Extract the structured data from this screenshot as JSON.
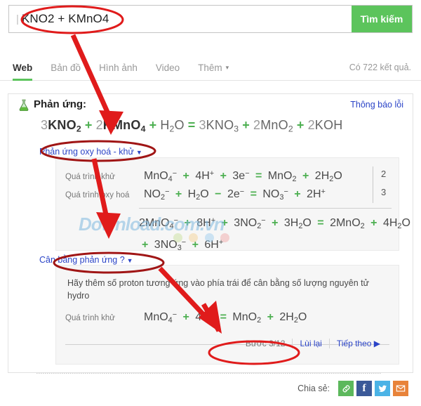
{
  "search": {
    "query": "KNO2 + KMnO4",
    "button_label": "Tìm kiếm",
    "caret_icon": "text-caret-icon"
  },
  "nav": {
    "tabs": [
      {
        "label": "Web",
        "active": true
      },
      {
        "label": "Bản đồ",
        "active": false
      },
      {
        "label": "Hình ảnh",
        "active": false
      },
      {
        "label": "Video",
        "active": false
      },
      {
        "label": "Thêm",
        "active": false,
        "caret": "▾"
      }
    ],
    "result_count": "Có 722 kết quả."
  },
  "card": {
    "icon": "flask-icon",
    "title": "Phản ứng:",
    "report_link": "Thông báo lỗi",
    "main_equation": {
      "left": [
        {
          "coef": "3",
          "formula": "KNO",
          "sub": "2",
          "highlight": true
        },
        {
          "coef": "2",
          "formula": "KMnO",
          "sub": "4",
          "highlight": true
        },
        {
          "coef": "",
          "formula": "H",
          "sub": "2",
          "formula2": "O",
          "highlight": false
        }
      ],
      "right": [
        {
          "coef": "3",
          "formula": "KNO",
          "sub": "3"
        },
        {
          "coef": "2",
          "formula": "MnO",
          "sub": "2"
        },
        {
          "coef": "2",
          "formula": "KOH",
          "sub": ""
        }
      ],
      "plus": "+",
      "equals": "="
    },
    "redox": {
      "toggle_label": "Phản ứng oxy hoá - khử",
      "toggle_caret": "▼",
      "rows": [
        {
          "label": "Quá trình khử",
          "equation_html": "MnO<sub>4</sub><sup>−</sup> <span class=\"op\">+</span> 4H<sup>+</sup> <span class=\"op\">+</span> 3e<sup>−</sup> <span class=\"eqs\">=</span> MnO<sub>2</sub> <span class=\"op\">+</span> 2H<sub>2</sub>O",
          "multiplier": "2"
        },
        {
          "label": "Quá trình oxy hoá",
          "equation_html": "NO<sub>2</sub><sup>−</sup> <span class=\"op\">+</span> H<sub>2</sub>O <span class=\"op\">−</span> 2e<sup>−</sup> <span class=\"eqs\">=</span> NO<sub>3</sub><sup>−</sup> <span class=\"op\">+</span> 2H<sup>+</sup>",
          "multiplier": "3"
        }
      ],
      "sum_equation_html": "2MnO<sub>4</sub><sup>−</sup> <span class=\"op\">+</span> 8H<sup>+</sup> <span class=\"op\">+</span> 3NO<sub>2</sub><sup>−</sup> <span class=\"op\">+</span> 3H<sub>2</sub>O <span class=\"op\">=</span> 2MnO<sub>2</sub> <span class=\"op\">+</span> 4H<sub>2</sub>O <span class=\"op\">+</span> 3NO<sub>3</sub><sup>−</sup> <span class=\"op\">+</span> 6H<sup>+</sup>"
    },
    "balance": {
      "toggle_label": "Cân bằng phản ứng ?",
      "toggle_caret": "▼",
      "hint": "Hãy thêm số proton tương ứng vào phía trái để cân bằng số lượng nguyên tử hydro",
      "row": {
        "label": "Quá trình khử",
        "equation_html": "MnO<sub>4</sub><sup>−</sup> <span class=\"op\">+</span> 4H<sup>+</sup> <span class=\"op\">=</span> MnO<sub>2</sub> <span class=\"op\">+</span> 2H<sub>2</sub>O"
      },
      "step_text": "Bước 3/12",
      "back_label": "Lùi lại",
      "next_label": "Tiếp theo ▶"
    }
  },
  "watermark": {
    "text": "Download.com.vn",
    "dot_colors": [
      "#cfe3a7",
      "#f5d6a0",
      "#a9d3ef",
      "#f2b2b2"
    ]
  },
  "share": {
    "label": "Chia sẻ:",
    "items": [
      {
        "name": "link-icon",
        "glyph": "⚭",
        "color": "#5cb85c"
      },
      {
        "name": "facebook-icon",
        "glyph": "f",
        "color": "#3b5998"
      },
      {
        "name": "twitter-icon",
        "glyph": "ᵕ",
        "color": "#4bb3e6"
      },
      {
        "name": "email-icon",
        "glyph": "✉",
        "color": "#e8833a"
      }
    ]
  },
  "colors": {
    "accent_green": "#5cc45c",
    "link_blue": "#2b44c7",
    "annotation_red": "#e01b1b"
  }
}
